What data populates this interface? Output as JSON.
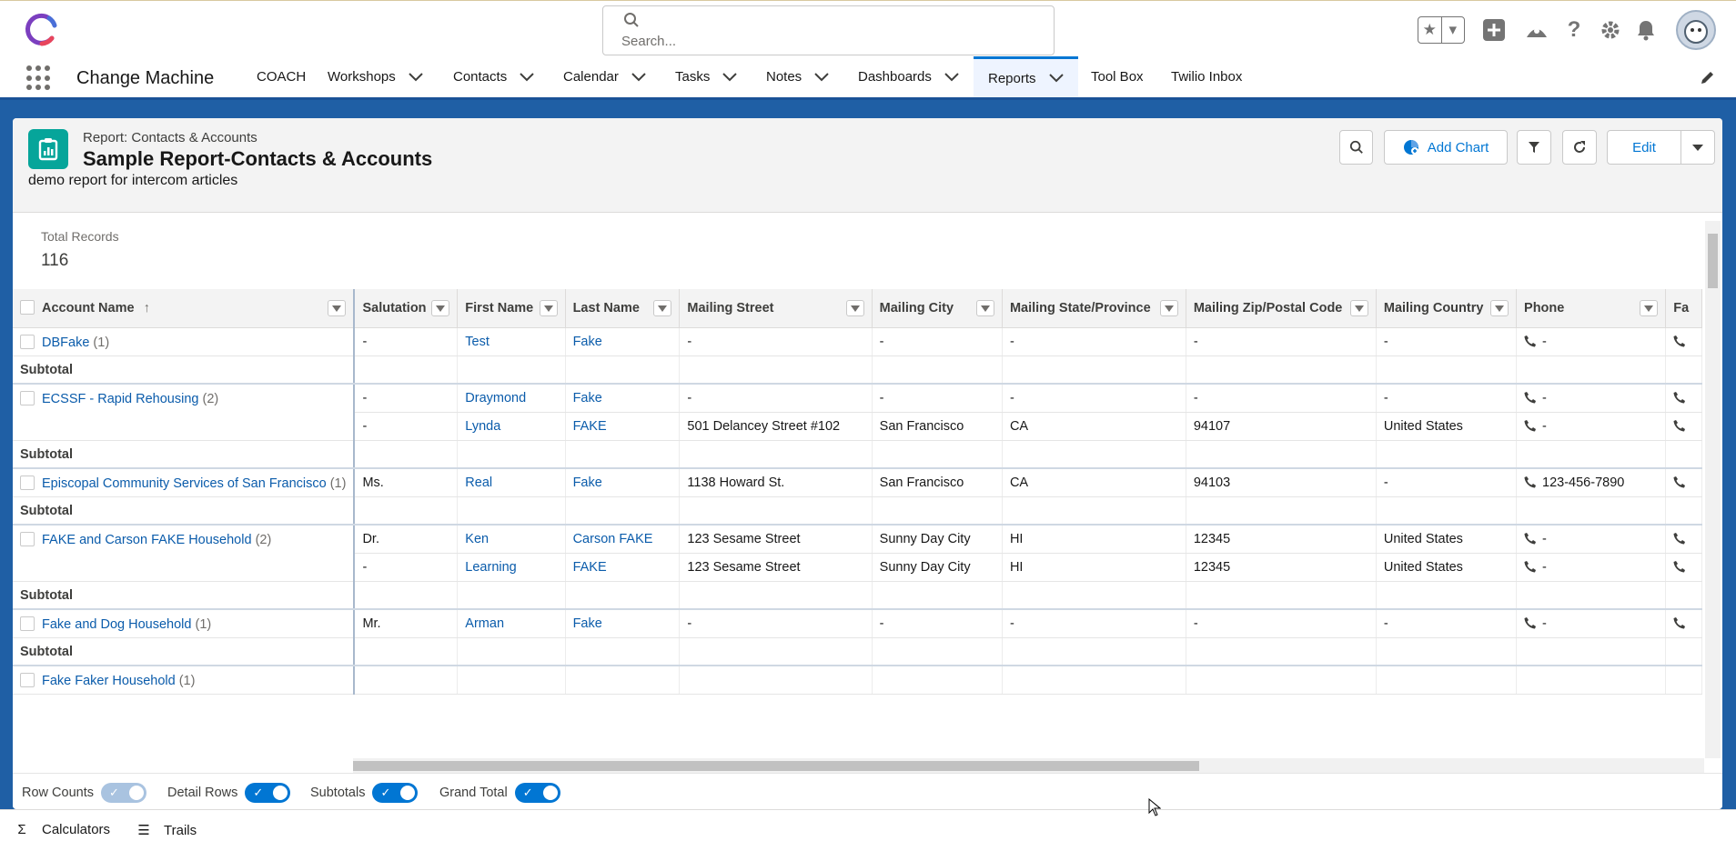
{
  "header": {
    "search_placeholder": "Search...",
    "app_name": "Change Machine"
  },
  "nav": {
    "items": [
      {
        "label": "COACH",
        "dropdown": false
      },
      {
        "label": "Workshops",
        "dropdown": true
      },
      {
        "label": "Contacts",
        "dropdown": true
      },
      {
        "label": "Calendar",
        "dropdown": true
      },
      {
        "label": "Tasks",
        "dropdown": true
      },
      {
        "label": "Notes",
        "dropdown": true
      },
      {
        "label": "Dashboards",
        "dropdown": true
      },
      {
        "label": "Reports",
        "dropdown": true,
        "active": true
      },
      {
        "label": "Tool Box",
        "dropdown": false
      },
      {
        "label": "Twilio Inbox",
        "dropdown": false
      }
    ]
  },
  "report": {
    "eyebrow": "Report: Contacts & Accounts",
    "title": "Sample Report-Contacts & Accounts",
    "description": "demo report for intercom articles",
    "add_chart_label": "Add Chart",
    "edit_label": "Edit",
    "total_label": "Total Records",
    "total_value": "116"
  },
  "table": {
    "columns": [
      "Account Name",
      "Salutation",
      "First Name",
      "Last Name",
      "Mailing Street",
      "Mailing City",
      "Mailing State/Province",
      "Mailing Zip/Postal Code",
      "Mailing Country",
      "Phone",
      "Fa"
    ],
    "sort_indicator": "↑",
    "subtotal_label": "Subtotal",
    "groups": [
      {
        "account": "DBFake",
        "count": "(1)",
        "rows": [
          [
            "-",
            "Test",
            "Fake",
            "-",
            "-",
            "-",
            "-",
            "-",
            "-"
          ]
        ]
      },
      {
        "account": "ECSSF - Rapid Rehousing",
        "count": "(2)",
        "rows": [
          [
            "-",
            "Draymond",
            "Fake",
            "-",
            "-",
            "-",
            "-",
            "-",
            "-"
          ],
          [
            "-",
            "Lynda",
            "FAKE",
            "501 Delancey Street #102",
            "San Francisco",
            "CA",
            "94107",
            "United States",
            "-"
          ]
        ]
      },
      {
        "account": "Episcopal Community Services of San Francisco",
        "count": "(1)",
        "rows": [
          [
            "Ms.",
            "Real",
            "Fake",
            "1138 Howard St.",
            "San Francisco",
            "CA",
            "94103",
            "-",
            "123-456-7890"
          ]
        ]
      },
      {
        "account": "FAKE and Carson FAKE Household",
        "count": "(2)",
        "rows": [
          [
            "Dr.",
            "Ken",
            "Carson FAKE",
            "123 Sesame Street",
            "Sunny Day City",
            "HI",
            "12345",
            "United States",
            "-"
          ],
          [
            "-",
            "Learning",
            "FAKE",
            "123 Sesame Street",
            "Sunny Day City",
            "HI",
            "12345",
            "United States",
            "-"
          ]
        ]
      },
      {
        "account": "Fake and Dog Household",
        "count": "(1)",
        "rows": [
          [
            "Mr.",
            "Arman",
            "Fake",
            "-",
            "-",
            "-",
            "-",
            "-",
            "-"
          ]
        ]
      },
      {
        "account": "Fake Faker Household",
        "count": "(1)",
        "rows": []
      }
    ]
  },
  "toggles": [
    {
      "label": "Row Counts",
      "on": false
    },
    {
      "label": "Detail Rows",
      "on": true
    },
    {
      "label": "Subtotals",
      "on": true
    },
    {
      "label": "Grand Total",
      "on": true
    }
  ],
  "utility_bar": {
    "calculators": "Calculators",
    "trails": "Trails"
  },
  "colors": {
    "brand_blue": "#0176d3",
    "link_blue": "#0b5cab",
    "report_icon": "#06a59a",
    "page_background": "#1f5fa5"
  }
}
